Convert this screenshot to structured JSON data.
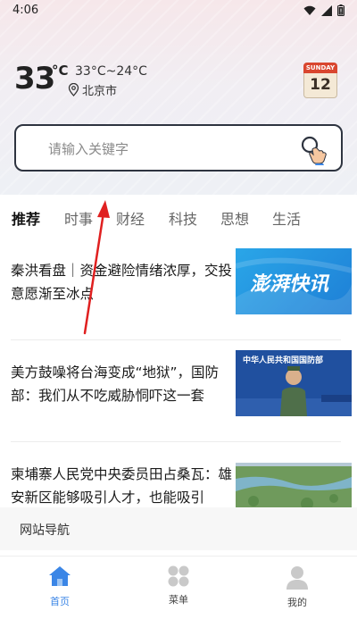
{
  "status_bar": {
    "time": "4:06"
  },
  "weather": {
    "temperature": "33",
    "unit": "°C",
    "range": "33°C~24°C",
    "location": "北京市"
  },
  "calendar": {
    "weekday": "SUNDAY",
    "day": "12"
  },
  "search": {
    "placeholder": "请输入关键字"
  },
  "tabs": [
    {
      "label": "推荐",
      "active": true
    },
    {
      "label": "时事"
    },
    {
      "label": "财经"
    },
    {
      "label": "科技"
    },
    {
      "label": "思想"
    },
    {
      "label": "生活"
    }
  ],
  "news": [
    {
      "title": "秦洪看盘｜资金避险情绪浓厚，交投意愿渐至冰点",
      "thumb_text": "澎湃快讯"
    },
    {
      "title": "美方鼓噪将台海变成“地狱”，国防部：我们从不吃威胁恫吓这一套",
      "thumb_text": "中华人民共和国国防部"
    },
    {
      "title": "柬埔寨人民党中央委员田占桑瓦：雄安新区能够吸引人才，也能吸引"
    }
  ],
  "site_nav": {
    "label": "网站导航"
  },
  "bottom_nav": [
    {
      "label": "首页",
      "active": true
    },
    {
      "label": "菜单"
    },
    {
      "label": "我的"
    }
  ],
  "colors": {
    "accent": "#3b86e6",
    "search_border": "#2e3440",
    "annotation_arrow": "#e02020"
  }
}
